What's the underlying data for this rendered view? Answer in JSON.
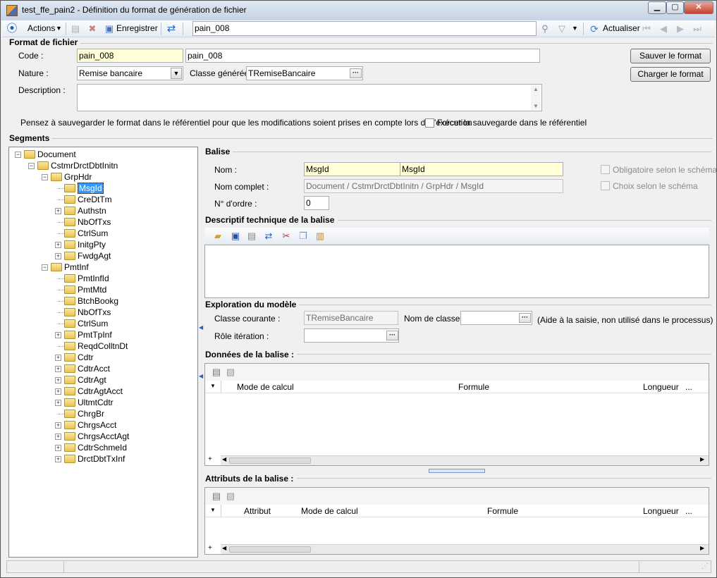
{
  "window": {
    "title": "test_ffe_pain2 -  Définition du format de génération de fichier",
    "min": "▁",
    "max": "▢",
    "close": "✕"
  },
  "toolbar": {
    "actions": "Actions",
    "save": "Enregistrer",
    "search_value": "pain_008",
    "refresh": "Actualiser"
  },
  "format": {
    "group": "Format de fichier",
    "code_label": "Code :",
    "code_value": "pain_008",
    "code_desc": "pain_008",
    "nature_label": "Nature :",
    "nature_value": "Remise bancaire",
    "class_label": "Classe générée :",
    "class_value": "TRemiseBancaire",
    "desc_label": "Description :",
    "note": "Pensez à sauvegarder le format dans le référentiel pour que les modifications soient prises en compte lors de l'exécution",
    "force_label": "Forcer la sauvegarde dans le référentiel",
    "btn_save": "Sauver le format",
    "btn_load": "Charger le format"
  },
  "segments": {
    "group": "Segments",
    "tree": [
      {
        "label": "Document",
        "level": 0,
        "pm": "-"
      },
      {
        "label": "CstmrDrctDbtInitn",
        "level": 1,
        "pm": "-"
      },
      {
        "label": "GrpHdr",
        "level": 2,
        "pm": "-"
      },
      {
        "label": "MsgId",
        "level": 3,
        "pm": "",
        "selected": true
      },
      {
        "label": "CreDtTm",
        "level": 3,
        "pm": ""
      },
      {
        "label": "Authstn",
        "level": 3,
        "pm": "+"
      },
      {
        "label": "NbOfTxs",
        "level": 3,
        "pm": ""
      },
      {
        "label": "CtrlSum",
        "level": 3,
        "pm": ""
      },
      {
        "label": "InitgPty",
        "level": 3,
        "pm": "+"
      },
      {
        "label": "FwdgAgt",
        "level": 3,
        "pm": "+"
      },
      {
        "label": "PmtInf",
        "level": 2,
        "pm": "-"
      },
      {
        "label": "PmtInfId",
        "level": 3,
        "pm": ""
      },
      {
        "label": "PmtMtd",
        "level": 3,
        "pm": ""
      },
      {
        "label": "BtchBookg",
        "level": 3,
        "pm": ""
      },
      {
        "label": "NbOfTxs",
        "level": 3,
        "pm": ""
      },
      {
        "label": "CtrlSum",
        "level": 3,
        "pm": ""
      },
      {
        "label": "PmtTpInf",
        "level": 3,
        "pm": "+"
      },
      {
        "label": "ReqdColltnDt",
        "level": 3,
        "pm": ""
      },
      {
        "label": "Cdtr",
        "level": 3,
        "pm": "+"
      },
      {
        "label": "CdtrAcct",
        "level": 3,
        "pm": "+"
      },
      {
        "label": "CdtrAgt",
        "level": 3,
        "pm": "+"
      },
      {
        "label": "CdtrAgtAcct",
        "level": 3,
        "pm": "+"
      },
      {
        "label": "UltmtCdtr",
        "level": 3,
        "pm": "+"
      },
      {
        "label": "ChrgBr",
        "level": 3,
        "pm": ""
      },
      {
        "label": "ChrgsAcct",
        "level": 3,
        "pm": "+"
      },
      {
        "label": "ChrgsAcctAgt",
        "level": 3,
        "pm": "+"
      },
      {
        "label": "CdtrSchmeId",
        "level": 3,
        "pm": "+"
      },
      {
        "label": "DrctDbtTxInf",
        "level": 3,
        "pm": "+"
      }
    ]
  },
  "balise": {
    "group": "Balise",
    "nom_label": "Nom  :",
    "nom_value": "MsgId",
    "nom_value2": "MsgId",
    "complet_label": "Nom complet :",
    "complet_value": "Document / CstmrDrctDbtInitn / GrpHdr / MsgId",
    "ordre_label": "N° d'ordre :",
    "ordre_value": "0",
    "oblig_label": "Obligatoire selon le schéma",
    "choix_label": "Choix selon le schéma"
  },
  "descriptif": {
    "group": "Descriptif technique de la balise"
  },
  "exploration": {
    "group": "Exploration du modèle",
    "classe_label": "Classe courante :",
    "classe_value": "TRemiseBancaire",
    "nomclasse_label": "Nom de classe :",
    "aide": "(Aide à la saisie, non utilisé dans le processus)",
    "role_label": "Rôle itération :"
  },
  "donnees": {
    "group": "Données de la balise :",
    "cols": [
      "Mode de calcul",
      "Formule",
      "Longueur",
      "..."
    ]
  },
  "attributs": {
    "group": "Attributs de la balise :",
    "cols": [
      "Attribut",
      "Mode de calcul",
      "Formule",
      "Longueur",
      "..."
    ]
  }
}
